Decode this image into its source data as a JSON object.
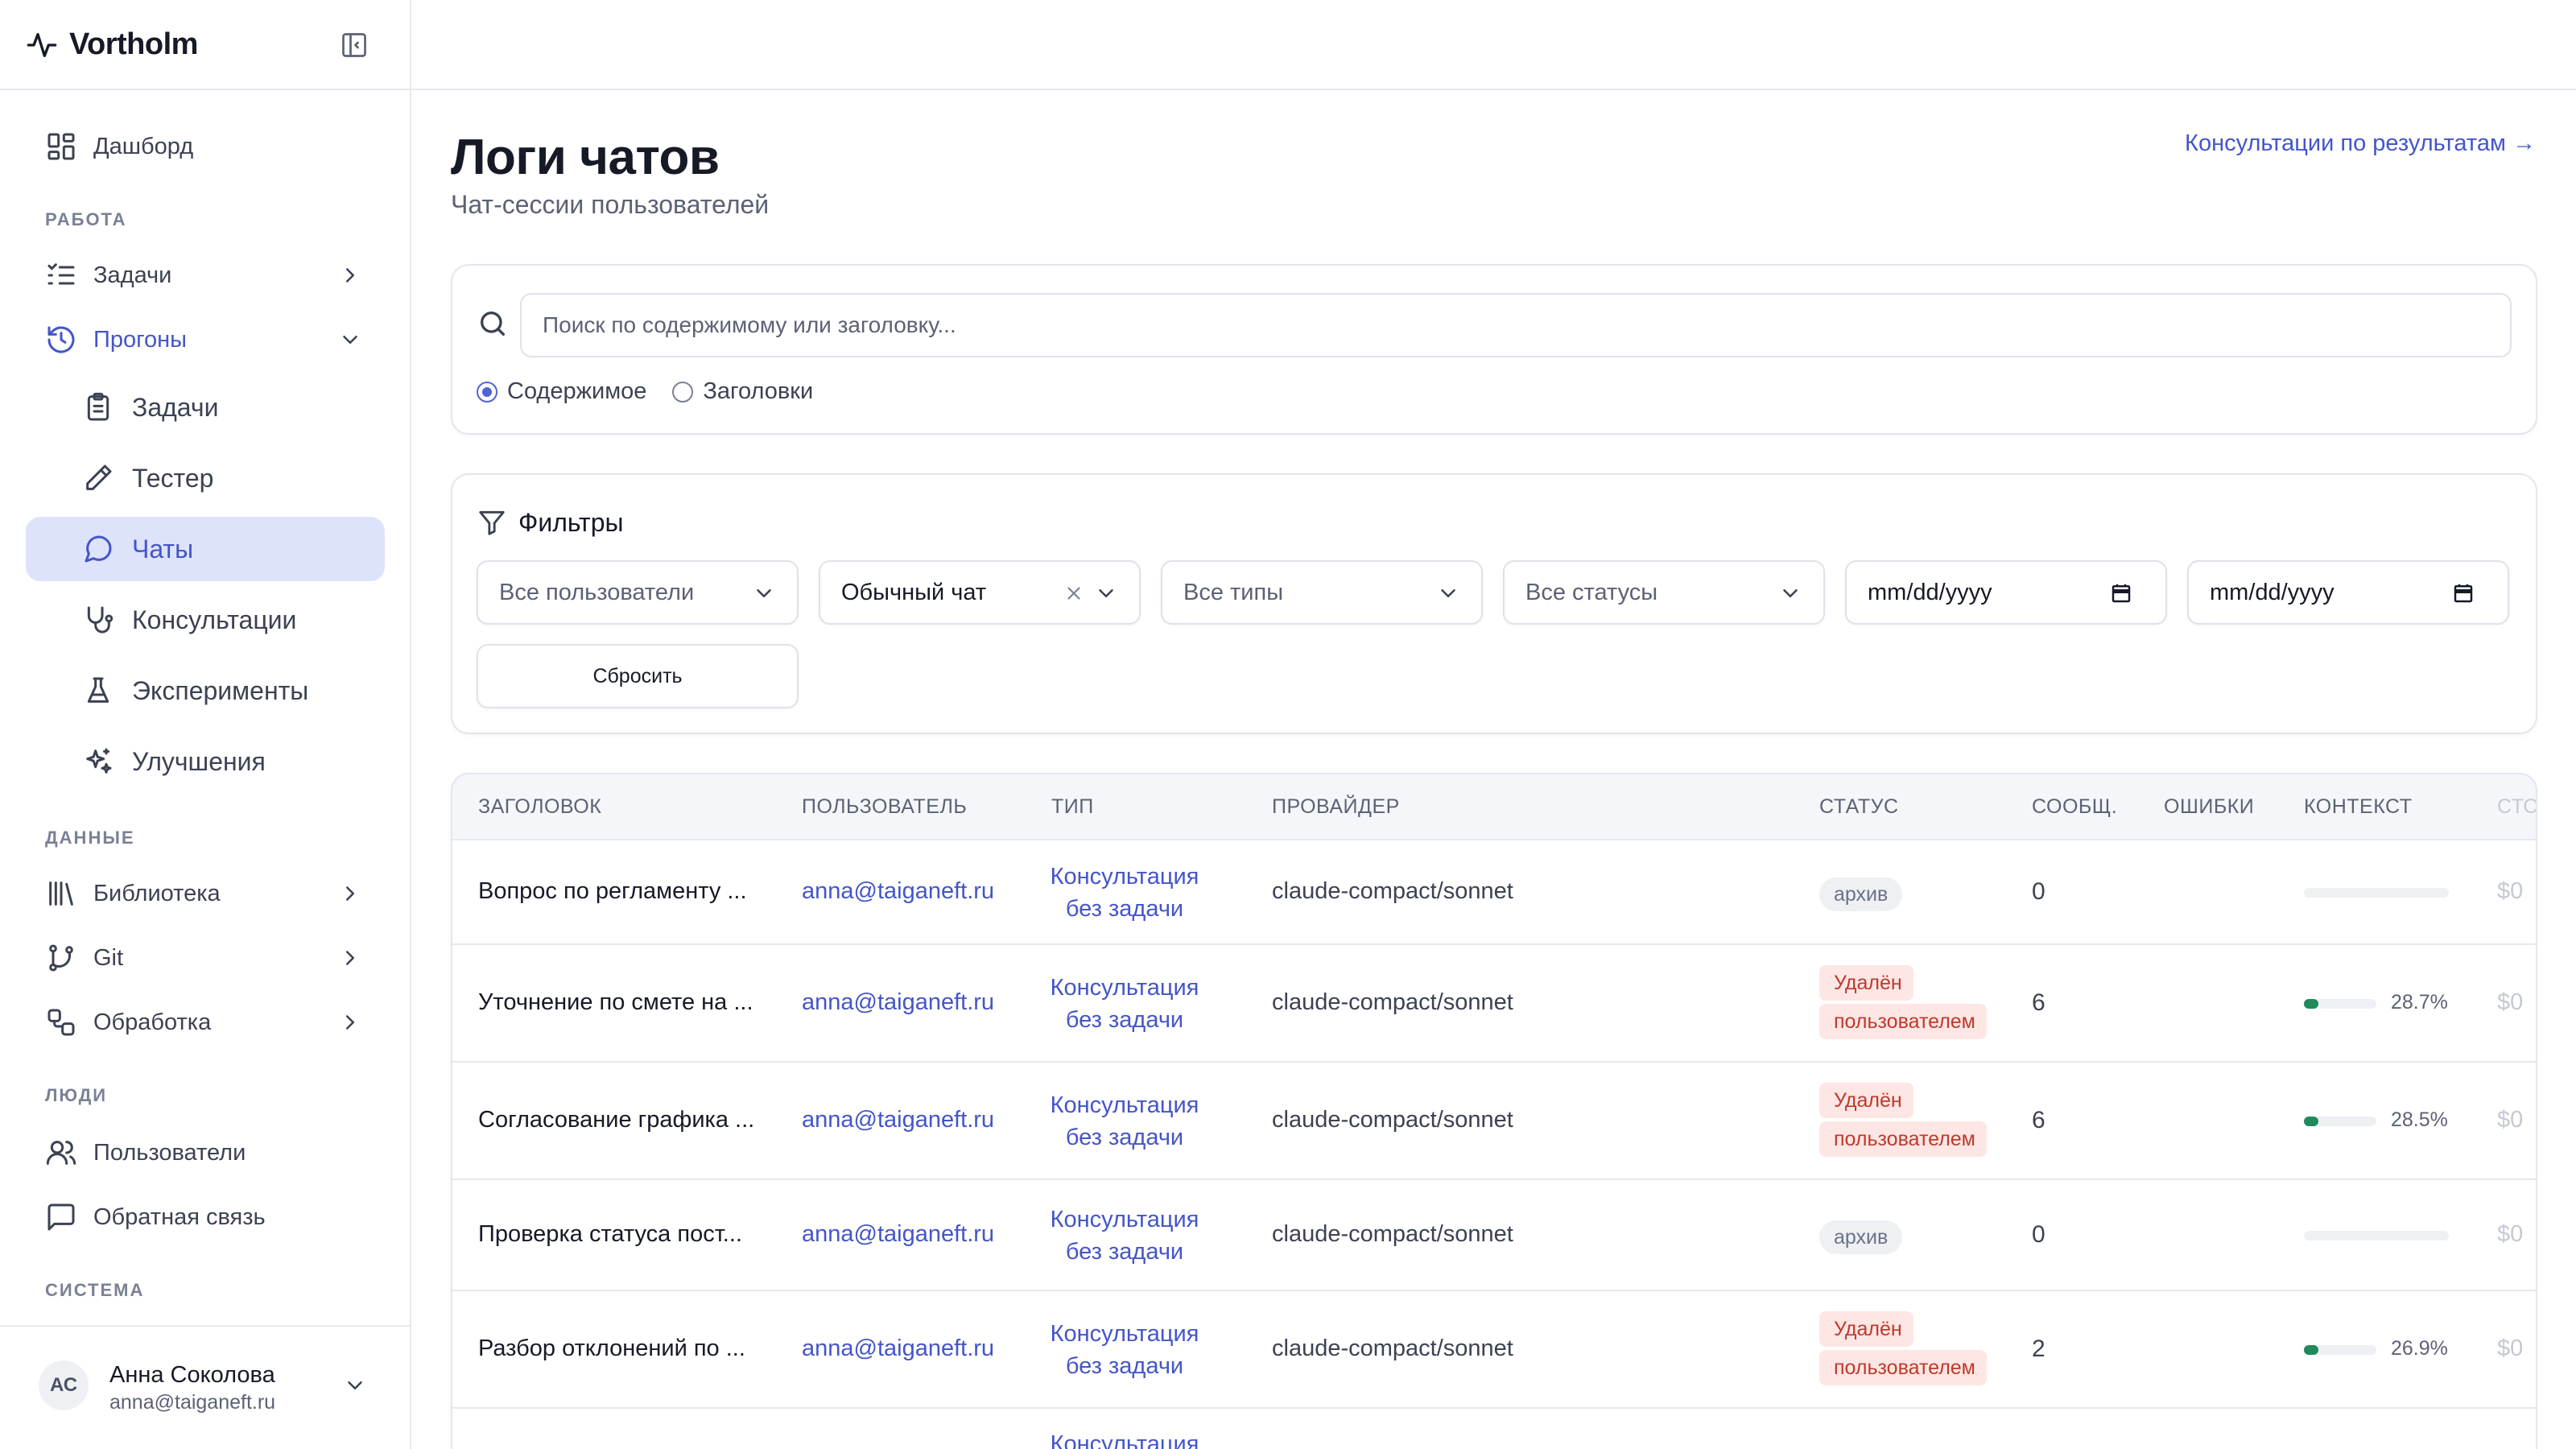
{
  "app": {
    "name": "Vortholm"
  },
  "sidebar": {
    "items": [
      {
        "label": "Дашборд",
        "icon": "dashboard-icon"
      },
      {
        "section": "РАБОТА"
      },
      {
        "label": "Задачи",
        "icon": "tasks-icon",
        "chevron": "right"
      },
      {
        "label": "Прогоны",
        "icon": "history-icon",
        "chevron": "down",
        "open": true
      },
      {
        "label": "Задачи",
        "icon": "clipboard-icon",
        "sub": true
      },
      {
        "label": "Тестер",
        "icon": "pencil-icon",
        "sub": true
      },
      {
        "label": "Чаты",
        "icon": "chat-icon",
        "sub": true,
        "active": true
      },
      {
        "label": "Консультации",
        "icon": "stethoscope-icon",
        "sub": true
      },
      {
        "label": "Эксперименты",
        "icon": "flask-icon",
        "sub": true
      },
      {
        "label": "Улучшения",
        "icon": "sparkles-icon",
        "sub": true
      },
      {
        "section": "ДАННЫЕ"
      },
      {
        "label": "Библиотека",
        "icon": "library-icon",
        "chevron": "right"
      },
      {
        "label": "Git",
        "icon": "git-branch-icon",
        "chevron": "right"
      },
      {
        "label": "Обработка",
        "icon": "workflow-icon",
        "chevron": "right"
      },
      {
        "section": "ЛЮДИ"
      },
      {
        "label": "Пользователи",
        "icon": "users-icon"
      },
      {
        "label": "Обратная связь",
        "icon": "message-square-icon"
      },
      {
        "section": "СИСТЕМА"
      }
    ],
    "sections": [
      "РАБОТА",
      "ДАННЫЕ",
      "ЛЮДИ",
      "СИСТЕМА"
    ],
    "user": {
      "initials": "АС",
      "name": "Анна Соколова",
      "email": "anna@taiganeft.ru"
    }
  },
  "main": {
    "title": "Логи чатов",
    "subtitle": "Чат-сессии пользователей",
    "top_link": "Консультации по результатам →",
    "search": {
      "placeholder": "Поиск по содержимому или заголовку...",
      "value": "",
      "modes": [
        "Содержимое",
        "Заголовки"
      ],
      "selected_mode": "Содержимое"
    },
    "filters": {
      "title": "Фильтры",
      "user": "Все пользователи",
      "chat_type": "Обычный чат",
      "type": "Все типы",
      "status": "Все статусы",
      "date_from": "mm/dd/yyyy",
      "date_to": "mm/dd/yyyy",
      "reset_label": "Сбросить"
    },
    "table": {
      "columns": [
        "ЗАГОЛОВОК",
        "ПОЛЬЗОВАТЕЛЬ",
        "ТИП",
        "ПРОВАЙДЕР",
        "СТАТУС",
        "СООБЩ.",
        "ОШИБКИ",
        "КОНТЕКСТ",
        "СТО"
      ],
      "rows": [
        {
          "title": "Вопрос по регламенту ...",
          "user": "anna@taiganeft.ru",
          "type": "Консультация без задачи",
          "provider": "claude-compact/sonnet",
          "status": "архив",
          "status_kind": "archive",
          "messages": "0",
          "errors": "",
          "context_fraction": 0,
          "context_label": "",
          "cost": "$0"
        },
        {
          "title": "Уточнение по смете на ...",
          "user": "anna@taiganeft.ru",
          "type": "Консультация без задачи",
          "provider": "claude-compact/sonnet",
          "status": "Удалён пользователем",
          "status_kind": "deleted",
          "messages": "6",
          "errors": "",
          "context_fraction": 0.287,
          "context_label": "28.7%",
          "cost": "$0"
        },
        {
          "title": "Согласование графика ...",
          "user": "anna@taiganeft.ru",
          "type": "Консультация без задачи",
          "provider": "claude-compact/sonnet",
          "status": "Удалён пользователем",
          "status_kind": "deleted",
          "messages": "6",
          "errors": "",
          "context_fraction": 0.285,
          "context_label": "28.5%",
          "cost": "$0"
        },
        {
          "title": "Проверка статуса пост...",
          "user": "anna@taiganeft.ru",
          "type": "Консультация без задачи",
          "provider": "claude-compact/sonnet",
          "status": "архив",
          "status_kind": "archive",
          "messages": "0",
          "errors": "",
          "context_fraction": 0,
          "context_label": "",
          "cost": "$0"
        },
        {
          "title": "Разбор отклонений по ...",
          "user": "anna@taiganeft.ru",
          "type": "Консультация без задачи",
          "provider": "claude-compact/sonnet",
          "status": "Удалён пользователем",
          "status_kind": "deleted",
          "messages": "2",
          "errors": "",
          "context_fraction": 0.269,
          "context_label": "26.9%",
          "cost": "$0"
        },
        {
          "title": "",
          "user": "",
          "type": "Консультация",
          "provider": "",
          "status": "",
          "status_kind": "pending",
          "messages": "",
          "errors": "",
          "context_fraction": 0,
          "context_label": "",
          "cost": ""
        }
      ]
    }
  },
  "colors": {
    "accent": "#4455c9",
    "active_bg": "#dde3fb",
    "deleted": "#c0392b",
    "deleted_bg": "#fde6e4",
    "context": "#1f8a5b"
  }
}
